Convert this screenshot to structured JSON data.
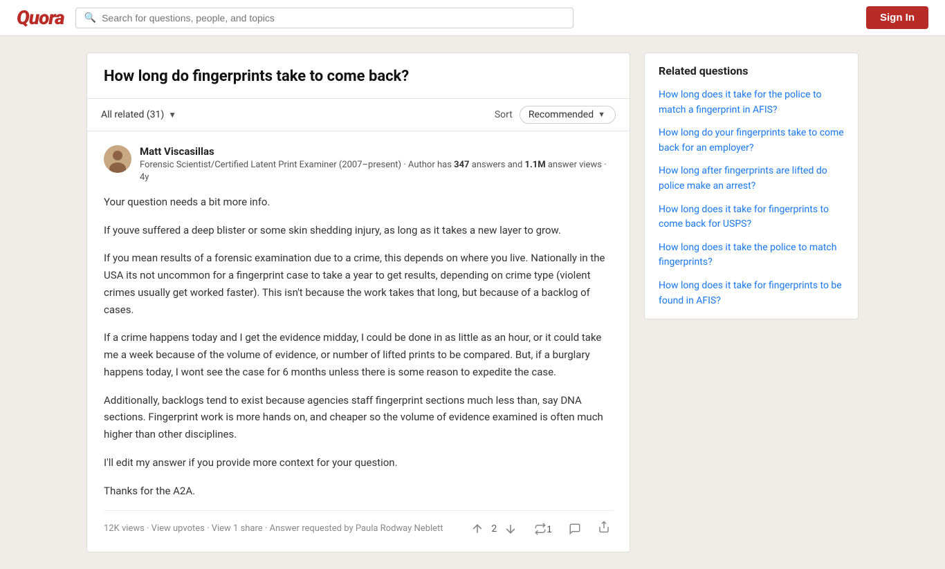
{
  "header": {
    "logo": "Quora",
    "search_placeholder": "Search for questions, people, and topics",
    "sign_in_label": "Sign In"
  },
  "question": {
    "title": "How long do fingerprints take to come back?",
    "filter_label": "All related (31)",
    "sort_label": "Sort",
    "sort_value": "Recommended"
  },
  "answer": {
    "author_name": "Matt Viscasillas",
    "author_bio_prefix": "Forensic Scientist/Certified Latent Print Examiner (2007–present) · Author has ",
    "author_answers": "347",
    "author_bio_mid": " answers and ",
    "author_views": "1.1M",
    "author_bio_suffix": " answer views · 4y",
    "paragraphs": [
      "Your question needs a bit more info.",
      "If youve suffered a deep blister or some skin shedding injury, as long as it takes a new layer to grow.",
      "If you mean results of a forensic examination due to a crime, this depends on where you live. Nationally in the USA its not uncommon for a fingerprint case to take a year to get results, depending on crime type (violent crimes usually get worked faster). This isn't because the work takes that long, but because of a backlog of cases.",
      "If a crime happens today and I get the evidence midday, I could be done in as little as an hour, or it could take me a week because of the volume of evidence, or number of lifted prints to be compared. But, if a burglary happens today, I wont see the case for 6 months unless there is some reason to expedite the case.",
      "Additionally, backlogs tend to exist because agencies staff fingerprint sections much less than, say DNA sections. Fingerprint work is more hands on, and cheaper so the volume of evidence examined is often much higher than other disciplines.",
      "I'll edit my answer if you provide more context for your question.",
      "Thanks for the A2A."
    ],
    "footer_stats": "12K views · View upvotes · View 1 share · Answer requested by Paula Rodway Neblett",
    "upvote_count": "2",
    "reshare_count": "1"
  },
  "related_questions": {
    "title": "Related questions",
    "items": [
      "How long does it take for the police to match a fingerprint in AFIS?",
      "How long do your fingerprints take to come back for an employer?",
      "How long after fingerprints are lifted do police make an arrest?",
      "How long does it take for fingerprints to come back for USPS?",
      "How long does it take the police to match fingerprints?",
      "How long does it take for fingerprints to be found in AFIS?"
    ]
  }
}
